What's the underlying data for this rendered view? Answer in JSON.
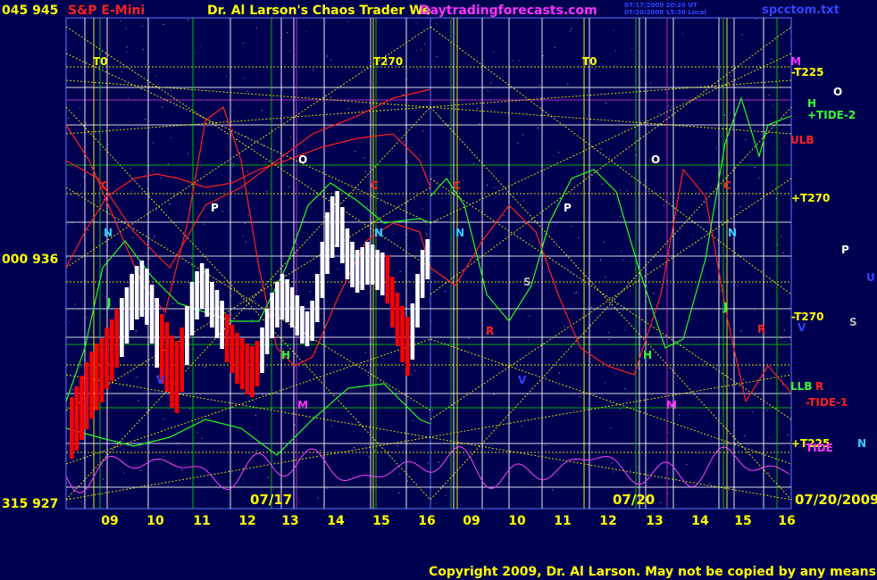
{
  "header": {
    "left_price": "045  945",
    "symbol": "S&P E-Mini",
    "title": "Dr. Al Larson's Chaos Trader We",
    "website": "Daytradingforecasts.com",
    "file": "spcctom.txt",
    "small_line1": "07/17/2009 20:20 UT",
    "small_line2": "07/20/2009 15:30 Local"
  },
  "footer": {
    "copyright": "Copyright 2009, Dr. Al Larson. May not be copied by any means."
  },
  "colors": {
    "background": "#000050",
    "grid_white": "#ffffff",
    "grid_green": "#00cc00",
    "grid_yellow": "#ffff00",
    "grid_magenta": "#cc33cc",
    "up_bar": "#ffffff",
    "down_bar": "#ff0000",
    "ulb": "#ff2020",
    "llb": "#20ff20",
    "tide": "#ff44ff",
    "brand_red": "#ff2020",
    "brand_magenta": "#ff33ff",
    "title_yellow": "#ffff00",
    "file_blue": "#3344ff",
    "axis_yellow": "#ffff00",
    "axis_green": "#33ff33"
  },
  "chart_data": {
    "type": "bar",
    "y_axis_left": [
      "045  945",
      "000  936",
      "315  927"
    ],
    "ylim": [
      927,
      945
    ],
    "x_ticks_day1": [
      "09",
      "10",
      "11",
      "12",
      "13",
      "14",
      "15",
      "16"
    ],
    "x_ticks_day2": [
      "09",
      "10",
      "11",
      "12",
      "13",
      "14",
      "15",
      "16"
    ],
    "date_labels": [
      "07/17",
      "07/20",
      "07/20/2009"
    ],
    "right_labels": [
      "M",
      "-T225",
      "H",
      "O",
      "+TIDE-2",
      "ULB",
      "+T270",
      "P",
      "U",
      "-T270",
      "V",
      "S",
      "LLB",
      "R",
      "-TIDE-1",
      "+T225",
      "TIDE",
      "N"
    ],
    "time_markers": [
      "T0",
      "T270",
      "T0"
    ],
    "chart_letters": [
      "C",
      "N",
      "O",
      "P",
      "C",
      "N",
      "C",
      "N",
      "O",
      "P",
      "C",
      "N",
      "S",
      "R",
      "H",
      "H",
      "V",
      "M",
      "M",
      "J",
      "J",
      "R",
      "V"
    ],
    "price_bars": [
      {
        "h": 931.0,
        "l": 928.7,
        "up": false
      },
      {
        "h": 931.4,
        "l": 929.0,
        "up": false
      },
      {
        "h": 931.8,
        "l": 929.4,
        "up": false
      },
      {
        "h": 932.3,
        "l": 929.8,
        "up": false
      },
      {
        "h": 932.7,
        "l": 930.2,
        "up": false
      },
      {
        "h": 933.0,
        "l": 930.5,
        "up": false
      },
      {
        "h": 933.2,
        "l": 930.8,
        "up": false
      },
      {
        "h": 933.6,
        "l": 931.3,
        "up": false
      },
      {
        "h": 933.9,
        "l": 931.6,
        "up": false
      },
      {
        "h": 934.3,
        "l": 932.1,
        "up": false
      },
      {
        "h": 934.7,
        "l": 932.5,
        "up": true
      },
      {
        "h": 935.1,
        "l": 933.0,
        "up": true
      },
      {
        "h": 935.6,
        "l": 933.5,
        "up": true
      },
      {
        "h": 935.9,
        "l": 933.9,
        "up": true
      },
      {
        "h": 936.1,
        "l": 934.0,
        "up": true
      },
      {
        "h": 935.8,
        "l": 933.7,
        "up": true
      },
      {
        "h": 935.2,
        "l": 933.0,
        "up": true
      },
      {
        "h": 934.7,
        "l": 932.1,
        "up": true
      },
      {
        "h": 934.1,
        "l": 931.5,
        "up": false
      },
      {
        "h": 933.8,
        "l": 931.2,
        "up": false
      },
      {
        "h": 933.3,
        "l": 930.6,
        "up": false
      },
      {
        "h": 933.1,
        "l": 930.4,
        "up": false
      },
      {
        "h": 933.6,
        "l": 931.2,
        "up": false
      },
      {
        "h": 934.4,
        "l": 932.2,
        "up": true
      },
      {
        "h": 935.3,
        "l": 933.3,
        "up": true
      },
      {
        "h": 935.7,
        "l": 933.9,
        "up": true
      },
      {
        "h": 936.0,
        "l": 934.3,
        "up": true
      },
      {
        "h": 935.8,
        "l": 934.0,
        "up": true
      },
      {
        "h": 935.3,
        "l": 933.6,
        "up": true
      },
      {
        "h": 935.0,
        "l": 933.2,
        "up": true
      },
      {
        "h": 934.6,
        "l": 932.8,
        "up": true
      },
      {
        "h": 934.1,
        "l": 932.3,
        "up": false
      },
      {
        "h": 933.7,
        "l": 931.9,
        "up": false
      },
      {
        "h": 933.4,
        "l": 931.5,
        "up": false
      },
      {
        "h": 933.2,
        "l": 931.3,
        "up": false
      },
      {
        "h": 933.0,
        "l": 931.1,
        "up": false
      },
      {
        "h": 932.9,
        "l": 931.0,
        "up": false
      },
      {
        "h": 933.1,
        "l": 931.4,
        "up": false
      },
      {
        "h": 933.6,
        "l": 931.9,
        "up": true
      },
      {
        "h": 934.3,
        "l": 932.6,
        "up": true
      },
      {
        "h": 934.9,
        "l": 933.2,
        "up": true
      },
      {
        "h": 935.3,
        "l": 933.6,
        "up": true
      },
      {
        "h": 935.6,
        "l": 933.9,
        "up": true
      },
      {
        "h": 935.4,
        "l": 933.8,
        "up": true
      },
      {
        "h": 935.1,
        "l": 933.6,
        "up": true
      },
      {
        "h": 934.8,
        "l": 933.3,
        "up": true
      },
      {
        "h": 934.4,
        "l": 933.0,
        "up": true
      },
      {
        "h": 934.2,
        "l": 932.9,
        "up": true
      },
      {
        "h": 934.6,
        "l": 933.1,
        "up": true
      },
      {
        "h": 935.6,
        "l": 933.8,
        "up": true
      },
      {
        "h": 936.8,
        "l": 934.7,
        "up": true
      },
      {
        "h": 937.9,
        "l": 935.6,
        "up": true
      },
      {
        "h": 938.5,
        "l": 936.2,
        "up": true
      },
      {
        "h": 938.7,
        "l": 936.6,
        "up": true
      },
      {
        "h": 938.1,
        "l": 936.0,
        "up": true
      },
      {
        "h": 937.3,
        "l": 935.4,
        "up": true
      },
      {
        "h": 936.8,
        "l": 935.1,
        "up": true
      },
      {
        "h": 936.5,
        "l": 934.9,
        "up": true
      },
      {
        "h": 936.6,
        "l": 935.0,
        "up": true
      },
      {
        "h": 936.8,
        "l": 935.2,
        "up": true
      },
      {
        "h": 936.7,
        "l": 935.2,
        "up": true
      },
      {
        "h": 936.5,
        "l": 935.0,
        "up": true
      },
      {
        "h": 936.4,
        "l": 934.8,
        "up": true
      },
      {
        "h": 936.3,
        "l": 934.5,
        "up": false
      },
      {
        "h": 935.5,
        "l": 933.6,
        "up": false
      },
      {
        "h": 934.9,
        "l": 932.9,
        "up": false
      },
      {
        "h": 934.4,
        "l": 932.3,
        "up": false
      },
      {
        "h": 934.0,
        "l": 931.8,
        "up": false
      },
      {
        "h": 934.5,
        "l": 932.4,
        "up": true
      },
      {
        "h": 935.6,
        "l": 933.6,
        "up": true
      },
      {
        "h": 936.5,
        "l": 934.7,
        "up": true
      },
      {
        "h": 936.9,
        "l": 935.4,
        "up": true
      }
    ]
  }
}
